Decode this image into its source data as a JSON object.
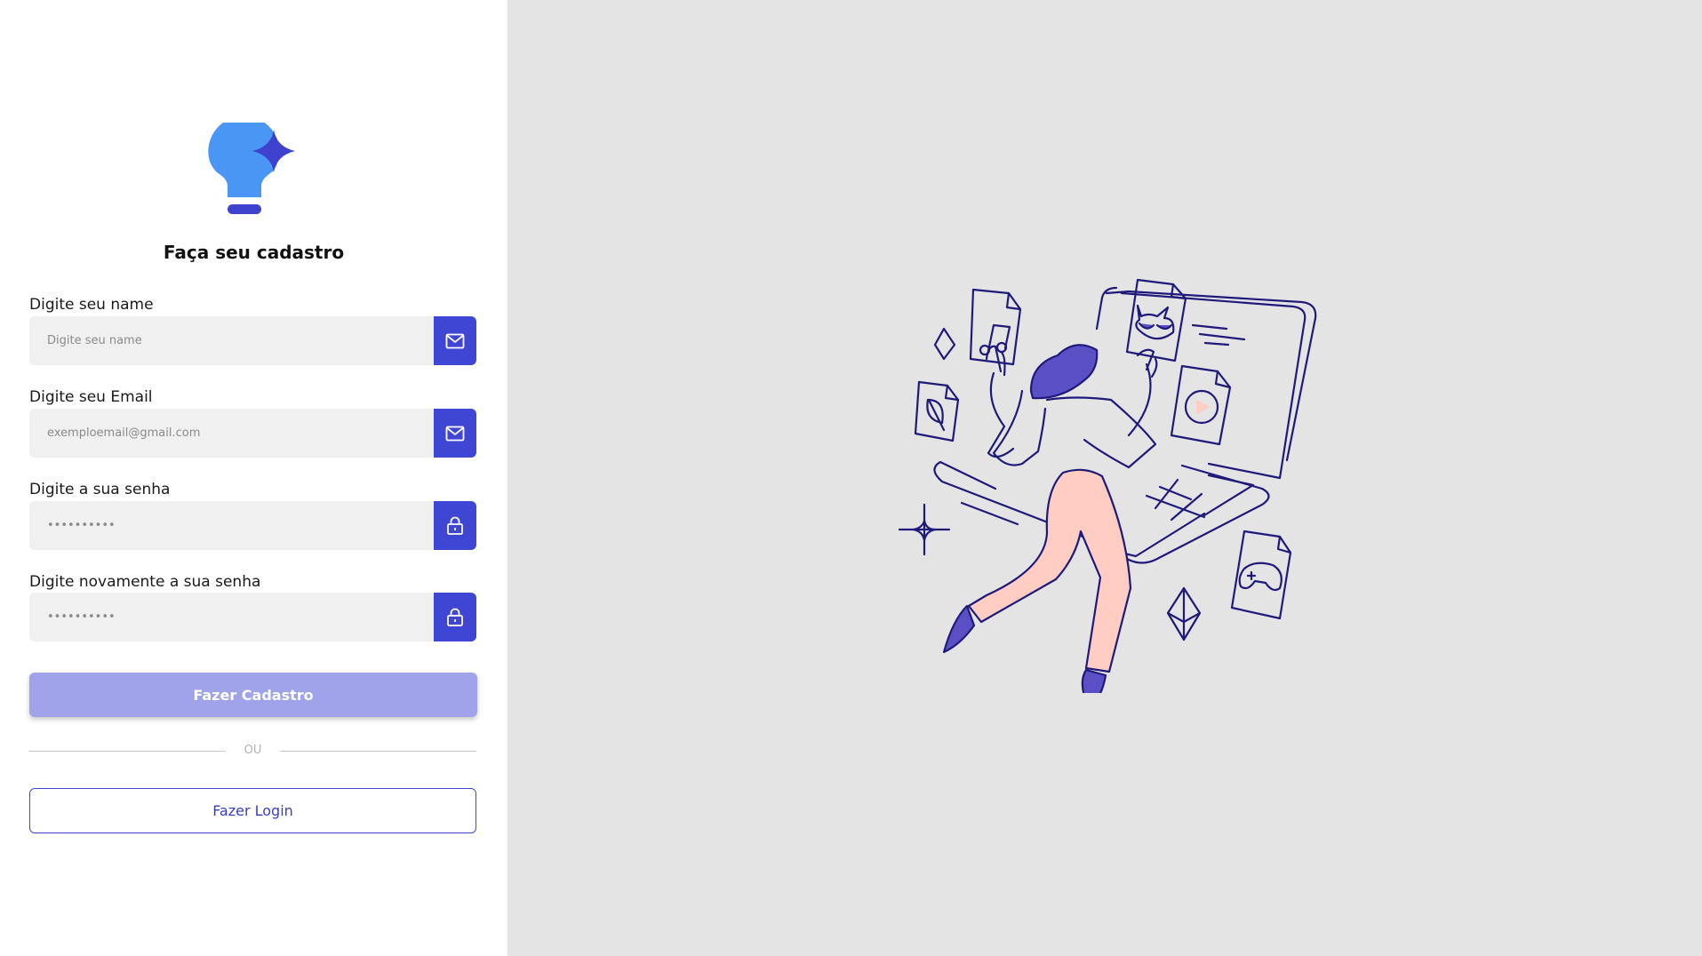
{
  "form": {
    "title": "Faça seu cadastro",
    "fields": [
      {
        "label": "Digite seu name",
        "placeholder": "Digite seu name",
        "icon": "mail-icon"
      },
      {
        "label": "Digite seu Email",
        "placeholder": "exemploemail@gmail.com",
        "icon": "mail-icon"
      },
      {
        "label": "Digite a sua senha",
        "placeholder": "••••••••••",
        "icon": "lock-icon"
      },
      {
        "label": "Digite novamente a sua senha",
        "placeholder": "••••••••••",
        "icon": "lock-icon"
      }
    ],
    "submit_label": "Fazer Cadastro",
    "divider_text": "OU",
    "login_label": "Fazer Login"
  },
  "colors": {
    "accent": "#4046d4",
    "submit_bg": "#a0a3e9",
    "logo_bulb": "#4a96f5",
    "right_bg": "#e4e4e5",
    "input_bg": "#f1f0f1",
    "illustration_stroke": "#1f1a7a",
    "illustration_pants": "#ffcdc2",
    "illustration_hair": "#5b4fc6"
  }
}
